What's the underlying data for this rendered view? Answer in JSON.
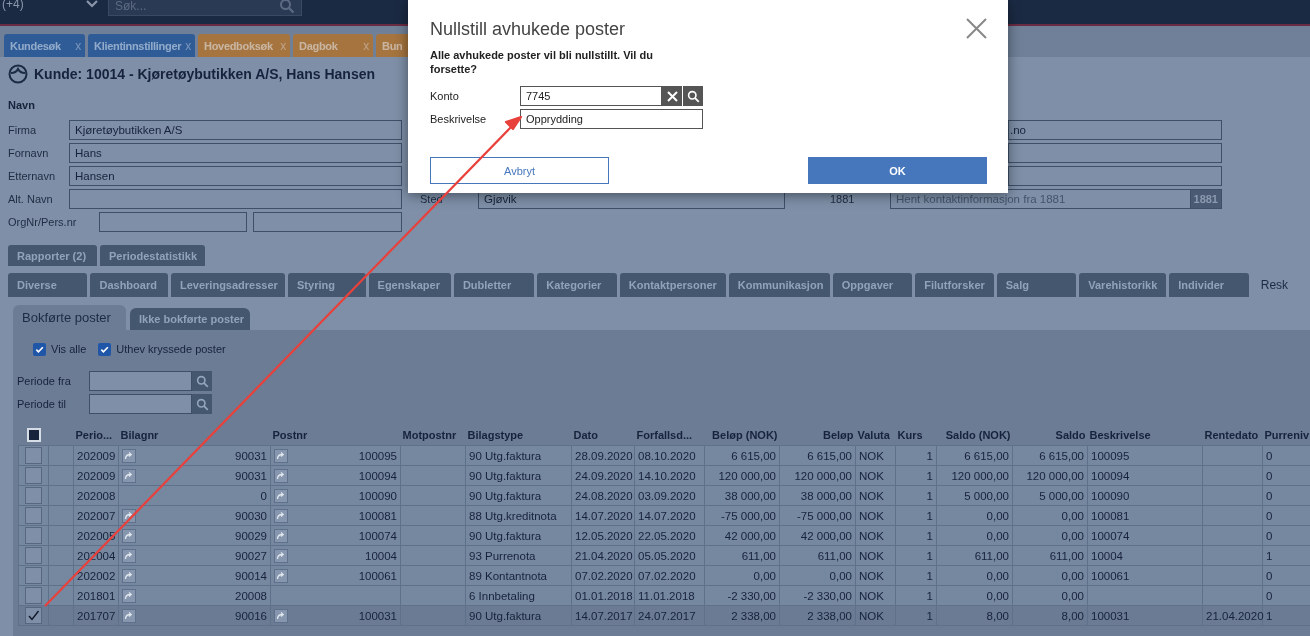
{
  "topbar": {
    "dropdown": "(+4)",
    "search": {
      "placeholder": "Søk..."
    }
  },
  "doc_tabs": [
    {
      "label": "Kundesøk",
      "close": "x",
      "color": "#2f5c97"
    },
    {
      "label": "Klientinnstillinger",
      "close": "x",
      "color": "#2f5c97"
    },
    {
      "label": "Hovedboksøk",
      "close": "x",
      "color": "#a5743f"
    },
    {
      "label": "Dagbok",
      "close": "x",
      "color": "#a5743f"
    },
    {
      "label": "Bun",
      "color": "#a5743f"
    }
  ],
  "customer": {
    "title": "Kunde: 10014 - Kjøretøybutikken A/S, Hans Hansen",
    "section": "Navn",
    "fields": [
      {
        "label": "Firma",
        "value": "Kjøretøybutikken A/S",
        "kind": "single"
      },
      {
        "label": "Fornavn",
        "value": "Hans",
        "kind": "single"
      },
      {
        "label": "Etternavn",
        "value": "Hansen",
        "kind": "single"
      },
      {
        "label": "Alt. Navn",
        "kind": "single"
      },
      {
        "label": "OrgNr/Pers.nr",
        "kind": "split"
      }
    ],
    "contact_fields": [
      {
        "value": ".no",
        "kind": "text"
      },
      {
        "kind": "empty"
      },
      {
        "kind": "empty"
      }
    ],
    "city": {
      "label": "Sted",
      "value": "Gjøvik"
    },
    "lookup": {
      "label": "1881",
      "placeholder": "Hent kontaktinformasjon fra 1881",
      "badge": "1881"
    }
  },
  "report_tabs": [
    {
      "label": "Rapporter (2)"
    },
    {
      "label": "Periodestatistikk"
    }
  ],
  "tabs": [
    {
      "label": "Diverse",
      "selected": false
    },
    {
      "label": "Dashboard",
      "selected": false
    },
    {
      "label": "Leveringsadresser",
      "selected": false
    },
    {
      "label": "Styring",
      "selected": false
    },
    {
      "label": "Egenskaper",
      "selected": false
    },
    {
      "label": "Dubletter",
      "selected": false
    },
    {
      "label": "Kategorier",
      "selected": false
    },
    {
      "label": "Kontaktpersoner",
      "selected": false
    },
    {
      "label": "Kommunikasjon",
      "selected": false
    },
    {
      "label": "Oppgaver",
      "selected": false
    },
    {
      "label": "Filutforsker",
      "selected": false
    },
    {
      "label": "Salg",
      "selected": false
    },
    {
      "label": "Varehistorikk",
      "selected": false
    },
    {
      "label": "Individer",
      "selected": false
    },
    {
      "label": "Resk",
      "selected": true
    }
  ],
  "ledger_tabs": [
    {
      "label": "Bokførte poster",
      "selected": true
    },
    {
      "label": "Ikke bokførte poster",
      "selected": false
    }
  ],
  "options": [
    {
      "label": "Vis alle",
      "checked": true
    },
    {
      "label": "Uthev kryssede poster",
      "checked": true
    }
  ],
  "period_fields": [
    {
      "label": "Periode fra"
    },
    {
      "label": "Periode til"
    }
  ],
  "table": {
    "select_all": {
      "indeterminate": true
    },
    "columns": [
      "Perio...",
      "Bilagnr",
      "Postnr",
      "Motpostnr",
      "Bilagstype",
      "Dato",
      "Forfallsd...",
      "Beløp (NOK)",
      "Beløp",
      "Valuta",
      "Kurs",
      "Saldo (NOK)",
      "Saldo",
      "Beskrivelse",
      "Rentedato",
      "Purreniv"
    ],
    "rows": [
      {
        "checked": false,
        "period": "202009",
        "voucher_link": true,
        "voucher": "90031",
        "entry_link": true,
        "entry": "100095",
        "voucher_type": "90 Utg.faktura",
        "date": "28.09.2020",
        "due_date": "08.10.2020",
        "amount_nok": "6 615,00",
        "amount": "6 615,00",
        "currency": "NOK",
        "rate": "1",
        "balance_nok": "6 615,00",
        "balance": "6 615,00",
        "description": "100095",
        "reminder_level": "0"
      },
      {
        "checked": false,
        "period": "202009",
        "voucher_link": true,
        "voucher": "90031",
        "entry_link": true,
        "entry": "100094",
        "voucher_type": "90 Utg.faktura",
        "date": "24.09.2020",
        "due_date": "14.10.2020",
        "amount_nok": "120 000,00",
        "amount": "120 000,00",
        "currency": "NOK",
        "rate": "1",
        "balance_nok": "120 000,00",
        "balance": "120 000,00",
        "description": "100094",
        "reminder_level": "0"
      },
      {
        "checked": false,
        "period": "202008",
        "voucher_link": false,
        "voucher": "0",
        "entry_link": true,
        "entry": "100090",
        "voucher_type": "90 Utg.faktura",
        "date": "24.08.2020",
        "due_date": "03.09.2020",
        "amount_nok": "38 000,00",
        "amount": "38 000,00",
        "currency": "NOK",
        "rate": "1",
        "balance_nok": "5 000,00",
        "balance": "5 000,00",
        "description": "100090",
        "reminder_level": "0"
      },
      {
        "checked": false,
        "period": "202007",
        "voucher_link": true,
        "voucher": "90030",
        "entry_link": true,
        "entry": "100081",
        "voucher_type": "88 Utg.kreditnota",
        "date": "14.07.2020",
        "due_date": "14.07.2020",
        "amount_nok": "-75 000,00",
        "amount": "-75 000,00",
        "currency": "NOK",
        "rate": "1",
        "balance_nok": "0,00",
        "balance": "0,00",
        "description": "100081",
        "reminder_level": "0"
      },
      {
        "checked": false,
        "period": "202005",
        "voucher_link": true,
        "voucher": "90029",
        "entry_link": true,
        "entry": "100074",
        "voucher_type": "90 Utg.faktura",
        "date": "12.05.2020",
        "due_date": "22.05.2020",
        "amount_nok": "42 000,00",
        "amount": "42 000,00",
        "currency": "NOK",
        "rate": "1",
        "balance_nok": "0,00",
        "balance": "0,00",
        "description": "100074",
        "reminder_level": "0"
      },
      {
        "checked": false,
        "period": "202004",
        "voucher_link": true,
        "voucher": "90027",
        "entry_link": true,
        "entry": "10004",
        "voucher_type": "93 Purrenota",
        "date": "21.04.2020",
        "due_date": "05.05.2020",
        "amount_nok": "611,00",
        "amount": "611,00",
        "currency": "NOK",
        "rate": "1",
        "balance_nok": "611,00",
        "balance": "611,00",
        "description": "10004",
        "reminder_level": "1"
      },
      {
        "checked": false,
        "period": "202002",
        "voucher_link": true,
        "voucher": "90014",
        "entry_link": true,
        "entry": "100061",
        "voucher_type": "89 Kontantnota",
        "date": "07.02.2020",
        "due_date": "07.02.2020",
        "amount_nok": "0,00",
        "amount": "0,00",
        "currency": "NOK",
        "rate": "1",
        "balance_nok": "0,00",
        "balance": "0,00",
        "description": "100061",
        "reminder_level": "0"
      },
      {
        "checked": false,
        "period": "201801",
        "voucher_link": true,
        "voucher": "20008",
        "entry_link": false,
        "voucher_type": "6 Innbetaling",
        "date": "01.01.2018",
        "due_date": "11.01.2018",
        "amount_nok": "-2 330,00",
        "amount": "-2 330,00",
        "currency": "NOK",
        "rate": "1",
        "balance_nok": "0,00",
        "balance": "0,00",
        "reminder_level": "0"
      },
      {
        "checked": true,
        "period": "201707",
        "voucher_link": true,
        "voucher": "90016",
        "entry_link": true,
        "entry": "100031",
        "voucher_type": "90 Utg.faktura",
        "date": "14.07.2017",
        "due_date": "24.07.2017",
        "amount_nok": "2 338,00",
        "amount": "2 338,00",
        "currency": "NOK",
        "rate": "1",
        "balance_nok": "8,00",
        "balance": "8,00",
        "description": "100031",
        "interest_date": "21.04.2020",
        "reminder_level": "1"
      }
    ]
  },
  "dialog": {
    "title": "Nullstill avhukede poster",
    "message": "Alle avhukede poster vil bli nullstillt. Vil du forsette?",
    "fields": [
      {
        "label": "Konto",
        "value": "7745",
        "kind": "lookup"
      },
      {
        "label": "Beskrivelse",
        "value": "Opprydding",
        "kind": "text"
      }
    ],
    "buttons": [
      {
        "label": "Avbryt",
        "kind": "secondary"
      },
      {
        "label": "OK",
        "kind": "primary"
      }
    ]
  },
  "annotation": {
    "kind": "arrow"
  }
}
